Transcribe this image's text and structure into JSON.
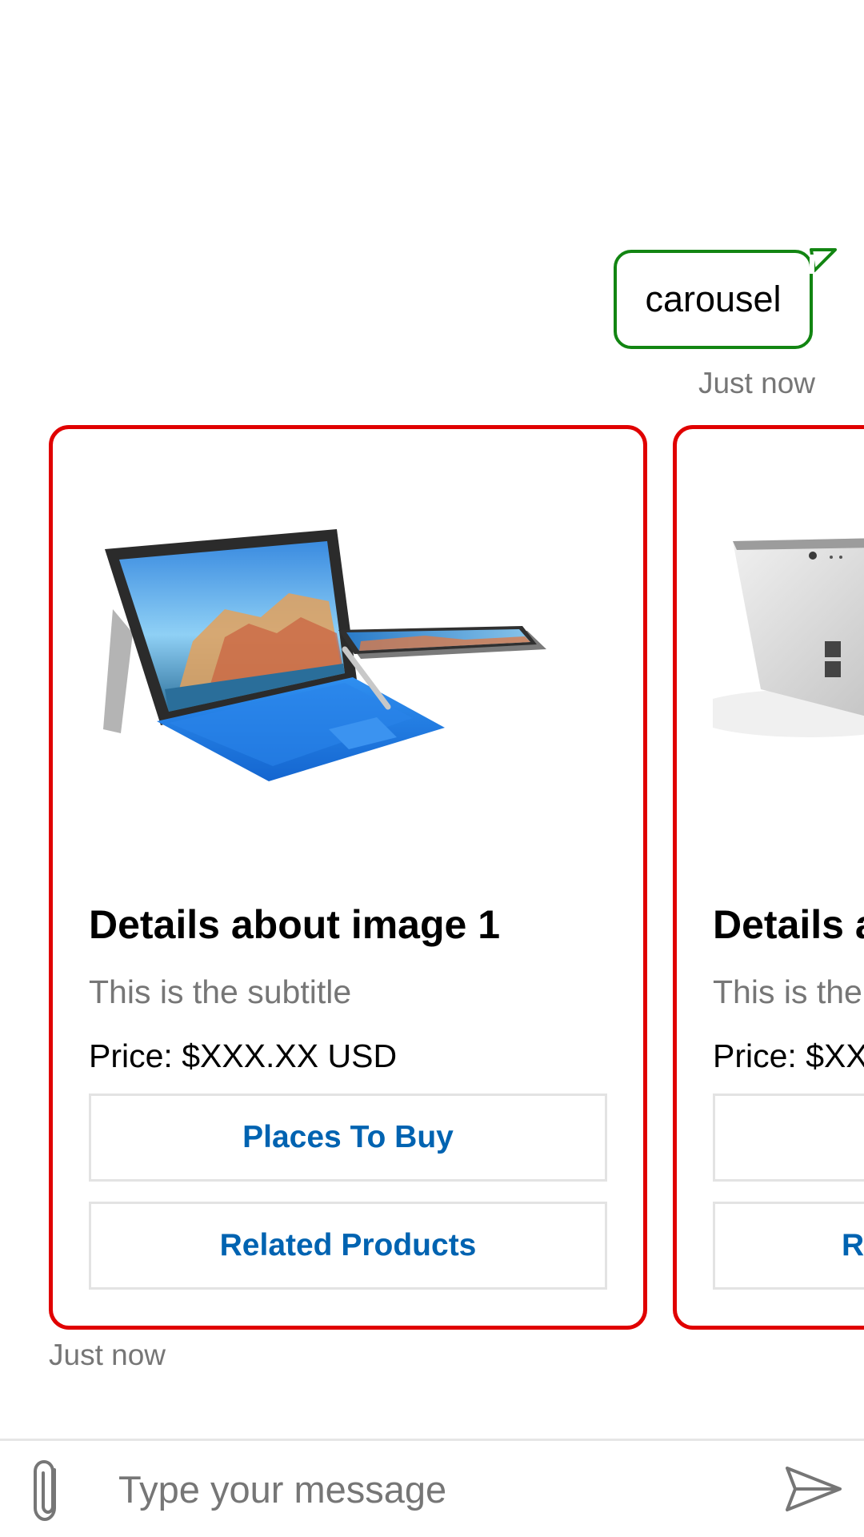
{
  "transcript": {
    "user_message": {
      "text": "carousel",
      "timestamp": "Just now",
      "border_color": "#128512"
    },
    "bot_message": {
      "timestamp": "Just now",
      "card_border_color": "#e00000",
      "cards": [
        {
          "image": "surface-pro-blue-keyboard-image",
          "title": "Details about image 1",
          "subtitle": "This is the subtitle",
          "price": "Price: $XXX.XX USD",
          "buttons": [
            "Places To Buy",
            "Related Products"
          ]
        },
        {
          "image": "surface-pro-back-kickstand-image",
          "title": "Details a",
          "subtitle": "This is the",
          "price": "Price: $XX",
          "buttons": [
            "",
            "R"
          ]
        }
      ]
    }
  },
  "sendbox": {
    "placeholder": "Type your message",
    "attach_icon": "paperclip-icon",
    "send_icon": "send-icon",
    "accent_color": "#0063b1"
  }
}
